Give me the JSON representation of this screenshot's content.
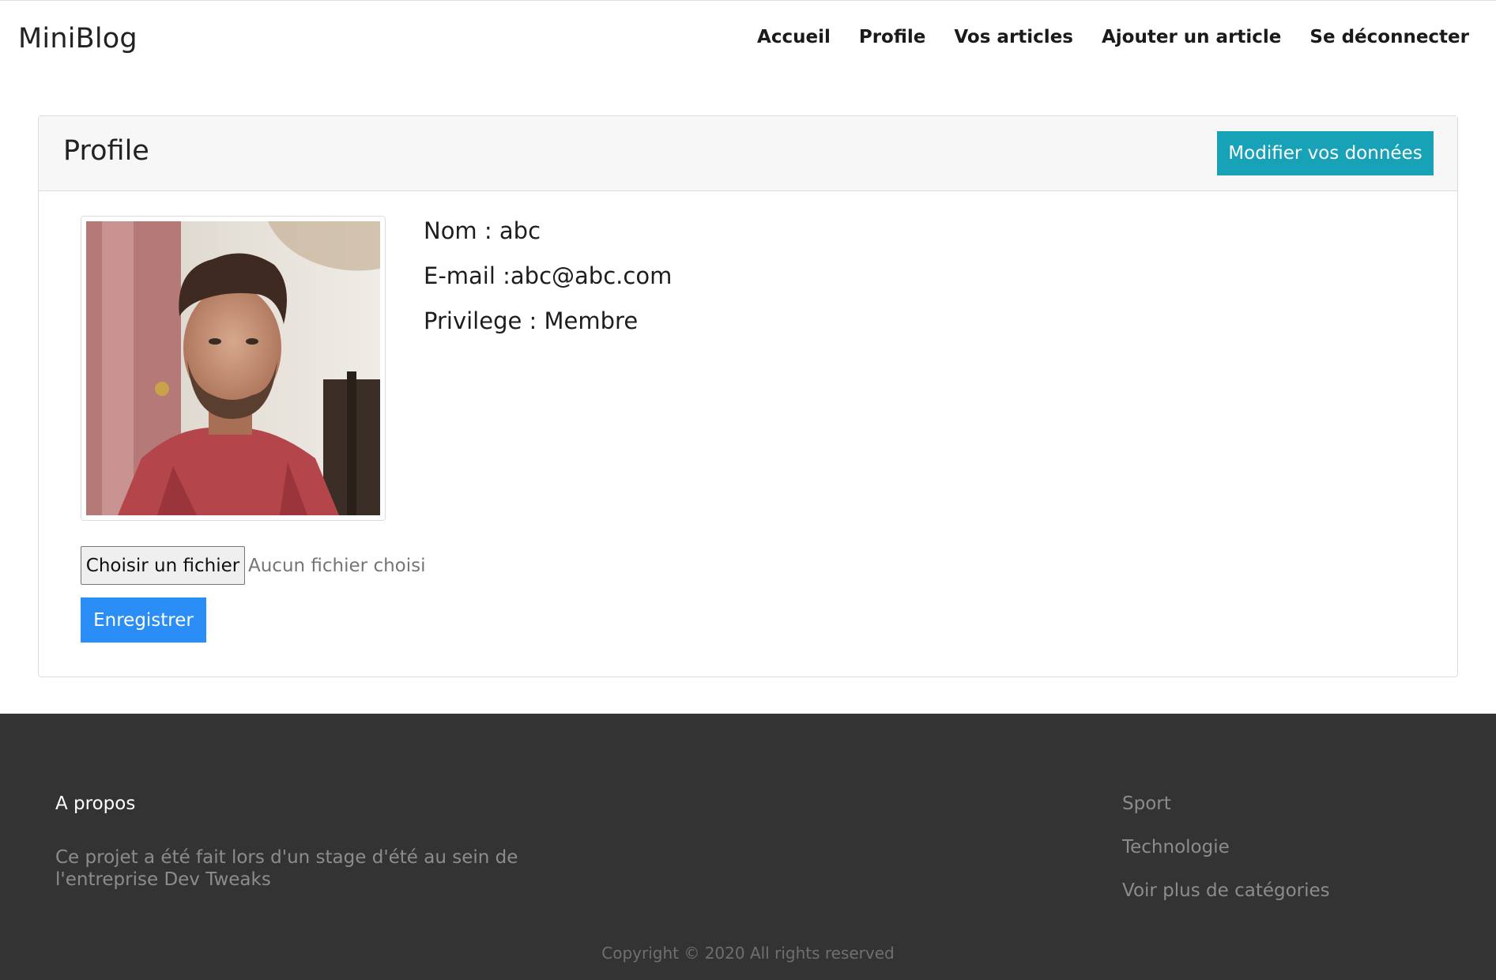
{
  "navbar": {
    "brand": "MiniBlog",
    "links": [
      "Accueil",
      "Profile",
      "Vos articles",
      "Ajouter un article",
      "Se déconnecter"
    ]
  },
  "profile": {
    "title": "Profile",
    "edit_button": "Modifier vos données",
    "photo_alt": "user-avatar-photo",
    "name_line": "Nom : abc",
    "email_line": "E-mail :abc@abc.com",
    "privilege_line": "Privilege : Membre",
    "file_button": "Choisir un fichier",
    "file_status": "Aucun fichier choisi",
    "save_button": "Enregistrer"
  },
  "footer": {
    "about_title": "A propos",
    "about_text": "Ce projet a été fait lors d'un stage d'été au sein de l'entreprise Dev Tweaks",
    "categories": [
      "Sport",
      "Technologie",
      "Voir plus de catégories"
    ],
    "copyright": "Copyright © 2020 All rights reserved"
  },
  "colors": {
    "accent_info": "#17a2b8",
    "accent_primary": "#2a8ef6",
    "footer_bg": "#333333"
  }
}
